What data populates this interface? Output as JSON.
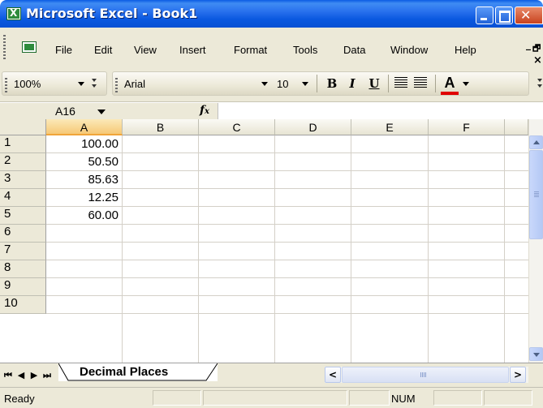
{
  "window": {
    "title": "Microsoft Excel - Book1"
  },
  "menu": {
    "items": [
      {
        "label": "File"
      },
      {
        "label": "Edit"
      },
      {
        "label": "View"
      },
      {
        "label": "Insert"
      },
      {
        "label": "Format"
      },
      {
        "label": "Tools"
      },
      {
        "label": "Data"
      },
      {
        "label": "Window"
      },
      {
        "label": "Help"
      }
    ],
    "min_glyph": "_",
    "restore_glyph": "🗗",
    "close_glyph": "×"
  },
  "toolbar": {
    "zoom": "100%",
    "font": "Arial",
    "font_size": "10",
    "bold": "B",
    "italic": "I",
    "underline": "U",
    "font_color_label": "A"
  },
  "formula_bar": {
    "cell_ref": "A16",
    "fx": "fx",
    "value": ""
  },
  "grid": {
    "columns": [
      "A",
      "B",
      "C",
      "D",
      "E",
      "F"
    ],
    "rows": [
      "1",
      "2",
      "3",
      "4",
      "5",
      "6",
      "7",
      "8",
      "9",
      "10"
    ],
    "cells": {
      "A1": "100.00",
      "A2": "50.50",
      "A3": "85.63",
      "A4": "12.25",
      "A5": "60.00"
    },
    "selected_column": "A"
  },
  "sheet_tabs": {
    "active": "Decimal Places"
  },
  "status_bar": {
    "left": "Ready",
    "num": "NUM"
  },
  "colors": {
    "title_bar": "#0a58e0",
    "chrome": "#ece9d8",
    "selected_header": "#f6c876",
    "font_color_underline": "#e00000"
  }
}
